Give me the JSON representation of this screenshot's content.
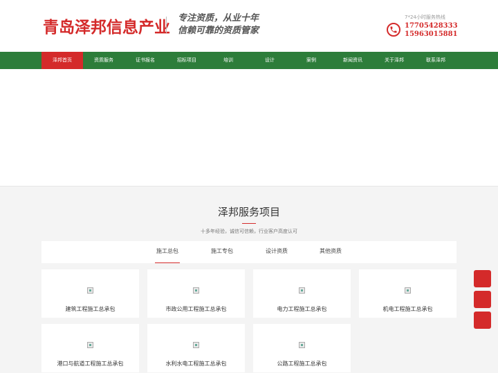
{
  "header": {
    "logo": "青岛泽邦信息产业",
    "slogan_line1": "专注资质，从业十年",
    "slogan_line2": "信赖可靠的资质管家",
    "hotline_label": "7*24小时服务热线",
    "phone1": "17705428333",
    "phone2": "15963015881"
  },
  "nav": {
    "items": [
      "泽邦首页",
      "资质服务",
      "证书报名",
      "招标项目",
      "培训",
      "设计",
      "案例",
      "新闻资讯",
      "关于泽邦",
      "联系泽邦"
    ]
  },
  "section": {
    "title": "泽邦服务项目",
    "subtitle": "十多年经验，诚信可信赖，行业客户高度认可"
  },
  "tabs": [
    "施工总包",
    "施工专包",
    "设计资质",
    "其他资质"
  ],
  "cards": [
    "建筑工程施工总承包",
    "市政公用工程施工总承包",
    "电力工程施工总承包",
    "机电工程施工总承包",
    "港口与航道工程施工总承包",
    "水利水电工程施工总承包",
    "公路工程施工总承包"
  ],
  "colors": {
    "brand_red": "#d42a2a",
    "nav_green": "#2d7d3a"
  }
}
